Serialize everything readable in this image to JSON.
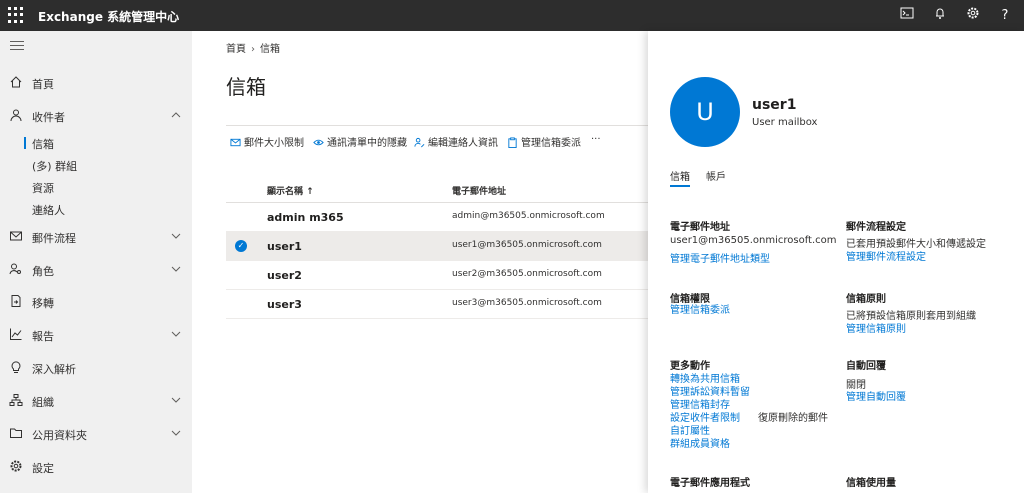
{
  "app": {
    "title": "Exchange 系統管理中心"
  },
  "sidebar": {
    "items": [
      {
        "label": "首頁"
      },
      {
        "label": "收件者"
      },
      {
        "label": "郵件流程"
      },
      {
        "label": "角色"
      },
      {
        "label": "移轉"
      },
      {
        "label": "報告"
      },
      {
        "label": "深入解析"
      },
      {
        "label": "組織"
      },
      {
        "label": "公用資料夾"
      },
      {
        "label": "設定"
      }
    ],
    "sub_items": [
      {
        "label": "信箱"
      },
      {
        "label": "(多) 群組"
      },
      {
        "label": "資源"
      },
      {
        "label": "連絡人"
      }
    ]
  },
  "breadcrumb": {
    "home": "首頁",
    "current": "信箱"
  },
  "main": {
    "title": "信箱",
    "commands": [
      {
        "label": "郵件大小限制"
      },
      {
        "label": "通訊清單中的隱藏"
      },
      {
        "label": "編輯連絡人資訊"
      },
      {
        "label": "管理信箱委派"
      },
      {
        "label": "···"
      }
    ],
    "columns": {
      "name": "顯示名稱 ↑",
      "email": "電子郵件地址"
    },
    "rows": [
      {
        "name": "admin m365",
        "email": "admin@m36505.onmicrosoft.com"
      },
      {
        "name": "user1",
        "email": "user1@m36505.onmicrosoft.com"
      },
      {
        "name": "user2",
        "email": "user2@m36505.onmicrosoft.com"
      },
      {
        "name": "user3",
        "email": "user3@m36505.onmicrosoft.com"
      }
    ]
  },
  "panel": {
    "avatar_letter": "U",
    "name": "user1",
    "type": "User mailbox",
    "tabs": [
      {
        "label": "信箱"
      },
      {
        "label": "帳戶"
      }
    ],
    "email_section": {
      "title": "電子郵件地址",
      "value": "user1@m36505.onmicrosoft.com",
      "link": "管理電子郵件地址類型"
    },
    "mailflow_section": {
      "title": "郵件流程設定",
      "value": "已套用預設郵件大小和傳遞設定",
      "link": "管理郵件流程設定"
    },
    "permissions_section": {
      "title": "信箱權限",
      "link": "管理信箱委派"
    },
    "policies_section": {
      "title": "信箱原則",
      "value": "已將預設信箱原則套用到組織",
      "link": "管理信箱原則"
    },
    "more_actions": {
      "title": "更多動作",
      "links": [
        "轉換為共用信箱",
        "管理訴訟資料暫留",
        "管理信箱封存",
        "設定收件者限制",
        "復原刪除的郵件",
        "自訂屬性",
        "群組成員資格"
      ]
    },
    "auto_reply": {
      "title": "自動回覆",
      "value": "關閉",
      "link": "管理自動回覆"
    },
    "email_apps": {
      "title": "電子郵件應用程式"
    },
    "mailbox_usage": {
      "title": "信箱使用量"
    }
  },
  "colors": {
    "accent": "#0078d4",
    "topbar": "#2d2d2d",
    "sidebar": "#f0f0f0"
  }
}
